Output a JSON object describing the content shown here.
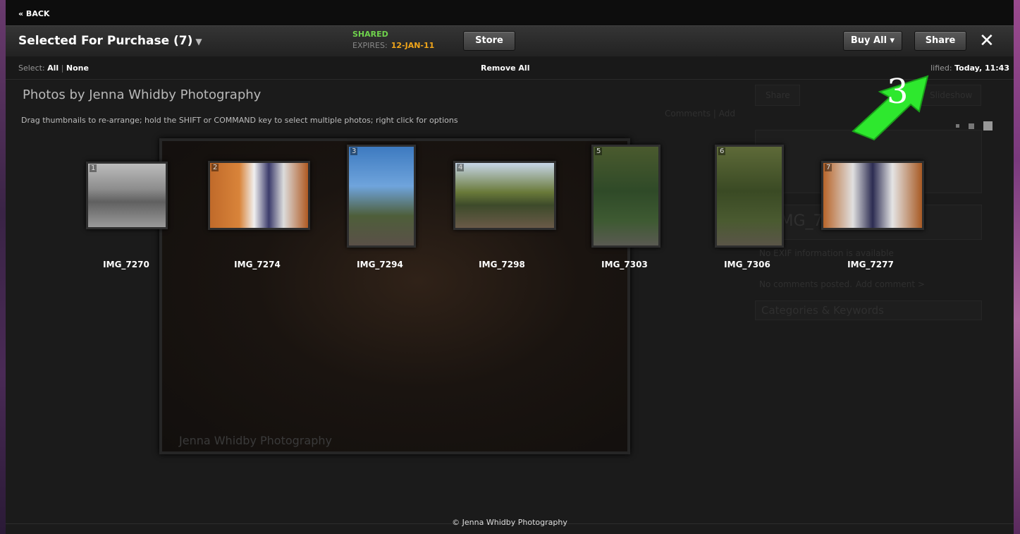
{
  "nav": {
    "back_label": "« BACK"
  },
  "header": {
    "set_title": "Selected For Purchase (7)",
    "shared_label": "SHARED",
    "expires_label": "EXPIRES:",
    "expires_date": "12-JAN-11",
    "store_label": "Store",
    "buy_all_label": "Buy All ▾",
    "share_label": "Share",
    "close_glyph": "✕"
  },
  "selectbar": {
    "select_prefix": "Select:",
    "all_label": "All",
    "separator": "|",
    "none_label": "None",
    "remove_all_label": "Remove All",
    "modified_prefix": "lified:",
    "modified_value": "Today, 11:43"
  },
  "gallery": {
    "title": "Photos by Jenna Whidby Photography",
    "instructions": "Drag thumbnails to re-arrange; hold the SHIFT or COMMAND key to select multiple photos; right click for options",
    "photos": [
      {
        "index": "1",
        "name": "IMG_7270"
      },
      {
        "index": "2",
        "name": "IMG_7274"
      },
      {
        "index": "3",
        "name": "IMG_7294"
      },
      {
        "index": "4",
        "name": "IMG_7298"
      },
      {
        "index": "5",
        "name": "IMG_7303"
      },
      {
        "index": "6",
        "name": "IMG_7306"
      },
      {
        "index": "7",
        "name": "IMG_7277"
      }
    ]
  },
  "background_overlay": {
    "watermark": "Jenna Whidby Photography",
    "share_btn": "Share",
    "slideshow_btn": "Slideshow",
    "comments_link": "Comments | Add",
    "image_name_partial": "IMG_727",
    "exif_text": "No EXIF information is available",
    "comments_text": "No comments posted.",
    "add_comment": "Add comment >",
    "categories": "Categories & Keywords"
  },
  "annotation": {
    "step_number": "3",
    "arrow_color": "#2ee82e"
  },
  "footer": {
    "copyright": "© Jenna Whidby Photography"
  },
  "colors": {
    "shared": "#6fd24c",
    "expires_date": "#f0a51a",
    "background": "#1b1b1b"
  }
}
